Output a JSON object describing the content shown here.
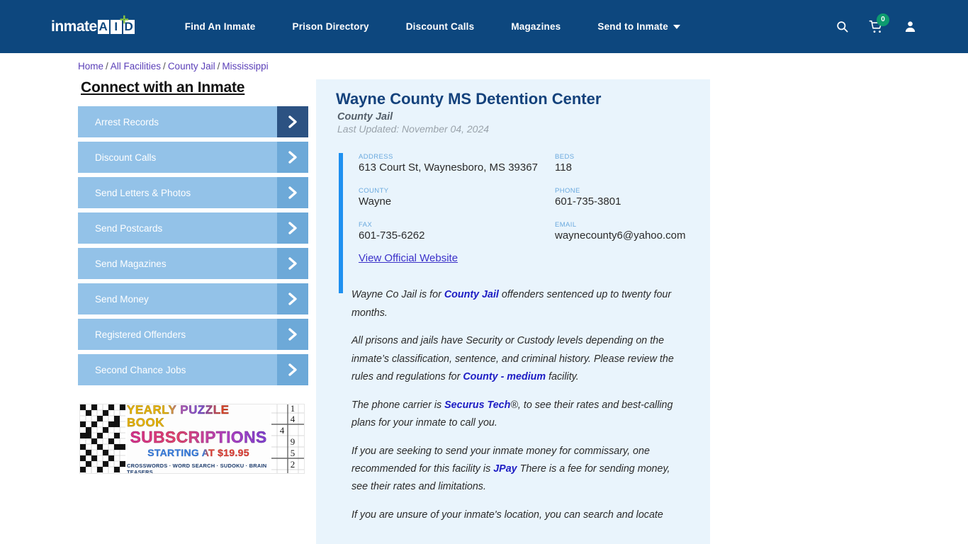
{
  "nav": {
    "logo_word": "inmate",
    "logo_boxes": [
      "A",
      "I",
      "D"
    ],
    "logo_cross": "✛",
    "links": [
      {
        "label": "Find An Inmate"
      },
      {
        "label": "Prison Directory"
      },
      {
        "label": "Discount Calls"
      },
      {
        "label": "Magazines"
      },
      {
        "label": "Send to Inmate",
        "has_caret": true
      }
    ],
    "search_icon": "search-icon",
    "cart_icon": "cart-icon",
    "cart_count": "0",
    "account_icon": "user-account-icon",
    "bg_color": "#0d477e",
    "badge_color": "#0d9b6f"
  },
  "breadcrumb": {
    "items": [
      "Home",
      "All Facilities",
      "County Jail",
      "Mississippi"
    ],
    "separator": "/",
    "link_color": "#5a3fb8"
  },
  "sidebar": {
    "title": "Connect with an Inmate",
    "items": [
      {
        "label": "Arrest Records",
        "active": true
      },
      {
        "label": "Discount Calls",
        "active": false
      },
      {
        "label": "Send Letters & Photos",
        "active": false
      },
      {
        "label": "Send Postcards",
        "active": false
      },
      {
        "label": "Send Magazines",
        "active": false
      },
      {
        "label": "Send Money",
        "active": false
      },
      {
        "label": "Registered Offenders",
        "active": false
      },
      {
        "label": "Second Chance Jobs",
        "active": false
      }
    ],
    "item_bg": "#93c2e8",
    "arrow_bg": "#6da9d8",
    "arrow_bg_active": "#2c5282"
  },
  "ad": {
    "line1": "YEARLY PUZZLE BOOK",
    "line2": "SUBSCRIPTIONS",
    "line3": "STARTING AT $19.95",
    "line4": "CROSSWORDS · WORD SEARCH · SUDOKU · BRAIN TEASERS",
    "sudoku_digits": [
      "1",
      "4",
      "4",
      "9",
      "5",
      "2"
    ]
  },
  "facility": {
    "name": "Wayne County MS Detention Center",
    "type": "County Jail",
    "last_updated": "Last Updated: November 04, 2024",
    "details": [
      {
        "label": "ADDRESS",
        "value": "613 Court St, Waynesboro, MS 39367"
      },
      {
        "label": "BEDS",
        "value": "118"
      },
      {
        "label": "COUNTY",
        "value": "Wayne"
      },
      {
        "label": "PHONE",
        "value": "601-735-3801"
      },
      {
        "label": "FAX",
        "value": "601-735-6262"
      },
      {
        "label": "EMAIL",
        "value": "waynecounty6@yahoo.com"
      }
    ],
    "official_site_link": "View Official Website",
    "accent_color": "#1e90f0",
    "card_bg": "#e9f4fc"
  },
  "body": {
    "p1_a": "Wayne Co Jail is for ",
    "p1_b": "County Jail",
    "p1_c": " offenders sentenced up to twenty four months.",
    "p2_a": "All prisons and jails have Security or Custody levels depending on the inmate’s classification, sentence, and criminal history. Please review the rules and regulations for ",
    "p2_b": "County - medium",
    "p2_c": " facility.",
    "p3_a": "The phone carrier is ",
    "p3_b": "Securus Tech",
    "p3_reg": "®",
    "p3_c": ", to see their rates and best-calling plans for your inmate to call you.",
    "p4_a": "If you are seeking to send your inmate money for commissary, one recommended for this facility is ",
    "p4_b": "JPay",
    "p4_c": " There is a fee for sending money, see their rates and limitations.",
    "p5_a": "If you are unsure of your inmate's location, you can search and locate"
  }
}
